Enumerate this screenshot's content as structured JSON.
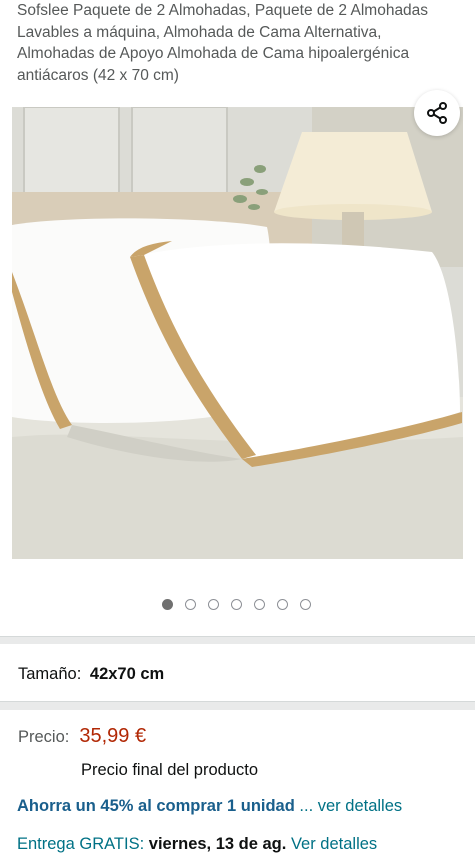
{
  "product": {
    "title": "Sofslee Paquete de 2 Almohadas, Paquete de 2 Almohadas Lavables a máquina, Almohada de Cama Alternativa, Almohadas de Apoyo Almohada de Cama hipoalergénica antiácaros (42 x 70 cm)"
  },
  "gallery": {
    "image_count": 7,
    "active_index": 0,
    "share_icon": "share-icon"
  },
  "size": {
    "label": "Tamaño:",
    "value": "42x70 cm"
  },
  "price": {
    "label": "Precio:",
    "value": "35,99 €",
    "final_note": "Precio final del producto"
  },
  "savings": {
    "bold_text": "Ahorra un 45% al comprar 1 unidad",
    "link_text": "... ver detalles"
  },
  "delivery": {
    "free_label": "Entrega GRATIS:",
    "date": "viernes, 13 de ag.",
    "link_text": "Ver detalles"
  },
  "colors": {
    "price": "#b12704",
    "link": "#007185",
    "gold_trim": "#c9a46a"
  }
}
